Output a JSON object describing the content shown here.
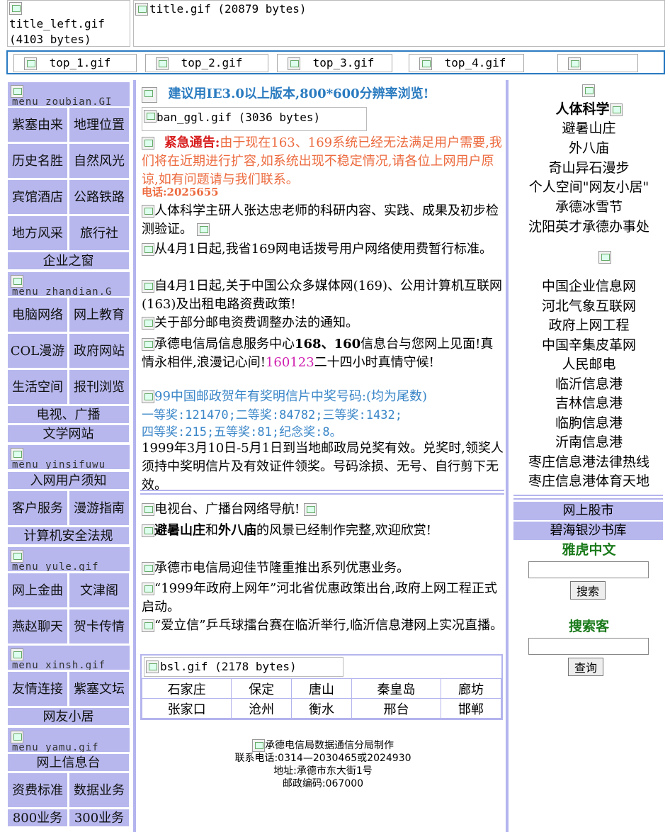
{
  "header": {
    "title_left_alt": "title_left.gif (4103 bytes)",
    "title_alt": "title.gif (20879 bytes)"
  },
  "topnav": [
    "top_1.gif",
    "top_2.gif",
    "top_3.gif",
    "top_4.gif",
    ""
  ],
  "left": {
    "banners": [
      "menu_zoubian.GI",
      "menu_zhandian.G",
      "menu_yinsifuwu",
      "menu_yule.gif",
      "menu_xinsh.gif",
      "menu_yamu.gif"
    ],
    "cells": {
      "c1": "紫塞由来",
      "c2": "地理位置",
      "c3": "历史名胜",
      "c4": "自然风光",
      "c5": "宾馆酒店",
      "c6": "公路铁路",
      "c7": "地方风采",
      "c8": "旅行社",
      "c9": "企业之窗",
      "c10": "电脑网络",
      "c11": "网上教育",
      "c12": "COL漫游",
      "c13": "政府网站",
      "c14": "生活空间",
      "c15": "报刊浏览",
      "c16": "电视、广播",
      "c17": "文学网站",
      "c18": "入网用户须知",
      "c19": "客户服务",
      "c20": "漫游指南",
      "c21": "计算机安全法规",
      "c22": "网上金曲",
      "c23": "文津阁",
      "c24": "燕赵聊天",
      "c25": "贺卡传情",
      "c26": "友情连接",
      "c27": "紫塞文坛",
      "c28": "网友小居",
      "c29": "网上信息台",
      "c30": "资费标准",
      "c31": "数据业务",
      "c32": "800业务",
      "c33": "300业务"
    }
  },
  "center": {
    "ie_notice": "建议用IE3.0以上版本,800*600分辨率浏览!",
    "banner_alt": "ban_ggl.gif (3036 bytes)",
    "urgent_label": "紧急通告:",
    "urgent_text": "由于现在163、169系统已经无法满足用户需要,我们将在近期进行扩容,如系统出现不稳定情况,请各位上网用户原谅,如有问题请与我们联系。",
    "urgent_phone": "电话:2025655",
    "news1": "人体科学主研人张达忠老师的科研内容、实践、成果及初步检测验证。",
    "news2": "从4月1日起,我省169网电话拨号用户网络使用费暂行标准。",
    "news3": "自4月1日起,关于中国公众多媒体网(169)、公用计算机互联网(163)及出租电路资费政策!",
    "news4": "关于部分邮电资费调整办法的通知。",
    "news5_a": "承德电信局信息服务中心",
    "news5_b": "168、160",
    "news5_c": "信息台与您网上见面!真情永相伴,浪漫记心间!",
    "news5_d": "160123",
    "news5_e": "二十四小时真情守候!",
    "lottery_title": "99中国邮政贺年有奖明信片中奖号码:(均为尾数)",
    "lottery_line1": "一等奖:121470;二等奖:84782;三等奖:1432;",
    "lottery_line2": "四等奖:215;五等奖:81;纪念奖:8。",
    "lottery_note": "1999年3月10日-5月1日到当地邮政局兑奖有效。兑奖时,领奖人须持中奖明信片及有效证件领奖。号码涂损、无号、自行剪下无效。",
    "tv_nav": "电视台、广播台网络导航!",
    "scenic_a": "避暑山庄",
    "scenic_b": "和",
    "scenic_c": "外八庙",
    "scenic_d": "的风景已经制作完整,欢迎欣赏!",
    "news6": "承德市电信局迎佳节隆重推出系列优惠业务。",
    "news7": "“1999年政府上网年”河北省优惠政策出台,政府上网工程正式启动。",
    "news8": "“爱立信”乒乓球擂台赛在临沂举行,临沂信息港网上实况直播。",
    "bsl_alt": "bsl.gif (2178 bytes)",
    "cities": [
      [
        "石家庄",
        "保定",
        "唐山",
        "秦皇岛",
        "廊坊"
      ],
      [
        "张家口",
        "沧州",
        "衡水",
        "邢台",
        "邯郸"
      ]
    ],
    "footer_alt": "承德电信局数据通信分局制作",
    "footer_phone": "联系电话:0314—2030465或2024930",
    "footer_addr": "地址:承德市东大街1号",
    "footer_zip": "邮政编码:067000"
  },
  "right": {
    "heading": "人体科学",
    "links1": [
      "避暑山庄",
      "外八庙",
      "奇山异石漫步",
      "个人空间\"网友小居\"",
      "承德冰雪节",
      "沈阳英才承德办事处"
    ],
    "links2": [
      "中国企业信息网",
      "河北气象互联网",
      "政府上网工程",
      "中国辛集皮革网",
      "人民邮电",
      "临沂信息港",
      "吉林信息港",
      "临朐信息港",
      "沂南信息港",
      "枣庄信息港法律热线",
      "枣庄信息港体育天地"
    ],
    "bars": [
      "网上股市",
      "碧海银沙书库"
    ],
    "yahoo_label": "雅虎中文",
    "yahoo_button": "搜索",
    "sohu_label": "搜索客",
    "sohu_button": "查询"
  }
}
